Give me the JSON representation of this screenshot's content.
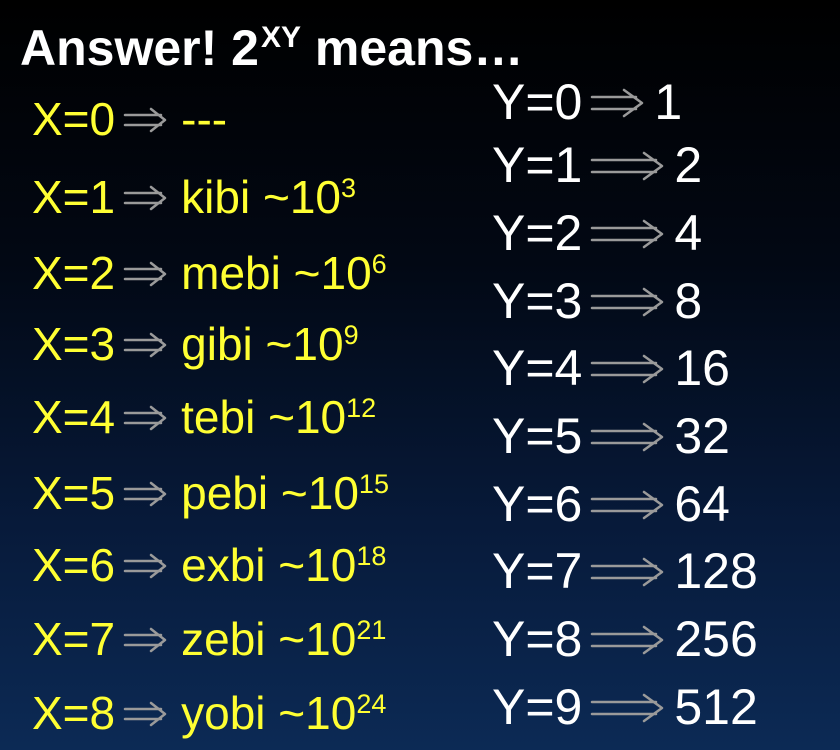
{
  "title": {
    "text": "Answer! 2",
    "sup": "XY",
    "suffix": " means…"
  },
  "arrow_icon": "double-right-arrow",
  "colors": {
    "x_text": "#ffff33",
    "y_text": "#ffffff",
    "arrow": "#9a9a9a"
  },
  "x_rows": [
    {
      "label": "X=0",
      "prefix": "---",
      "approx": "",
      "exp": ""
    },
    {
      "label": "X=1",
      "prefix": "kibi",
      "approx": " ~10",
      "exp": "3"
    },
    {
      "label": "X=2",
      "prefix": "mebi",
      "approx": " ~10",
      "exp": "6"
    },
    {
      "label": "X=3",
      "prefix": "gibi",
      "approx": " ~10",
      "exp": "9"
    },
    {
      "label": "X=4",
      "prefix": "tebi",
      "approx": " ~10",
      "exp": "12"
    },
    {
      "label": "X=5",
      "prefix": "pebi",
      "approx": " ~10",
      "exp": "15"
    },
    {
      "label": "X=6",
      "prefix": "exbi",
      "approx": " ~10",
      "exp": "18"
    },
    {
      "label": "X=7",
      "prefix": "zebi",
      "approx": " ~10",
      "exp": "21"
    },
    {
      "label": "X=8",
      "prefix": "yobi",
      "approx": " ~10",
      "exp": "24"
    }
  ],
  "y_rows": [
    {
      "label": "Y=0",
      "value": "1"
    },
    {
      "label": "Y=1",
      "value": "2"
    },
    {
      "label": "Y=2",
      "value": "4"
    },
    {
      "label": "Y=3",
      "value": "8"
    },
    {
      "label": "Y=4",
      "value": "16"
    },
    {
      "label": "Y=5",
      "value": "32"
    },
    {
      "label": "Y=6",
      "value": "64"
    },
    {
      "label": "Y=7",
      "value": "128"
    },
    {
      "label": "Y=8",
      "value": "256"
    },
    {
      "label": "Y=9",
      "value": "512"
    }
  ]
}
